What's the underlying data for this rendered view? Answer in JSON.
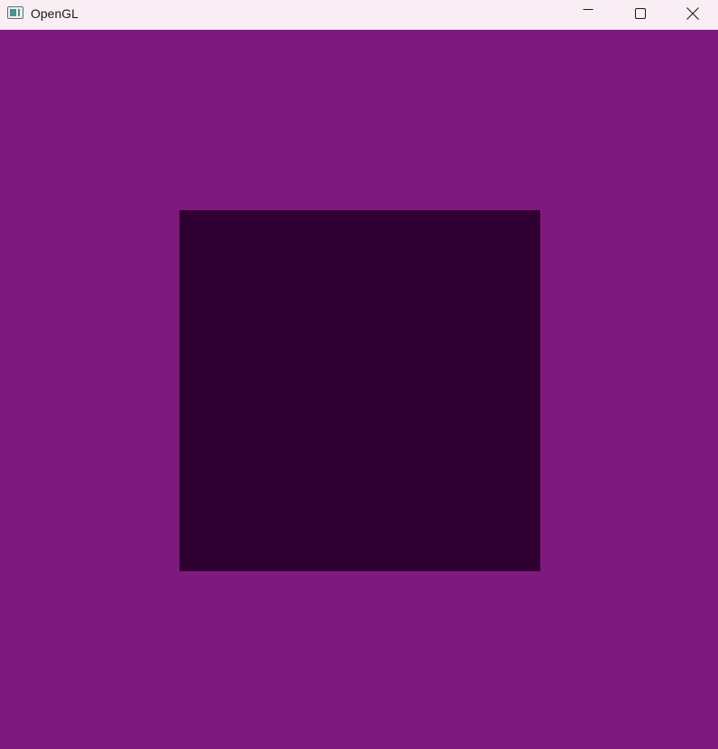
{
  "window": {
    "title": "OpenGL",
    "controls": {
      "minimize_icon": "minimize-icon",
      "maximize_icon": "maximize-icon",
      "close_icon": "close-icon"
    }
  },
  "colors": {
    "titlebar_bg": "#f8eef4",
    "clear_color": "#7e1a7d",
    "quad_color": "#310032"
  }
}
